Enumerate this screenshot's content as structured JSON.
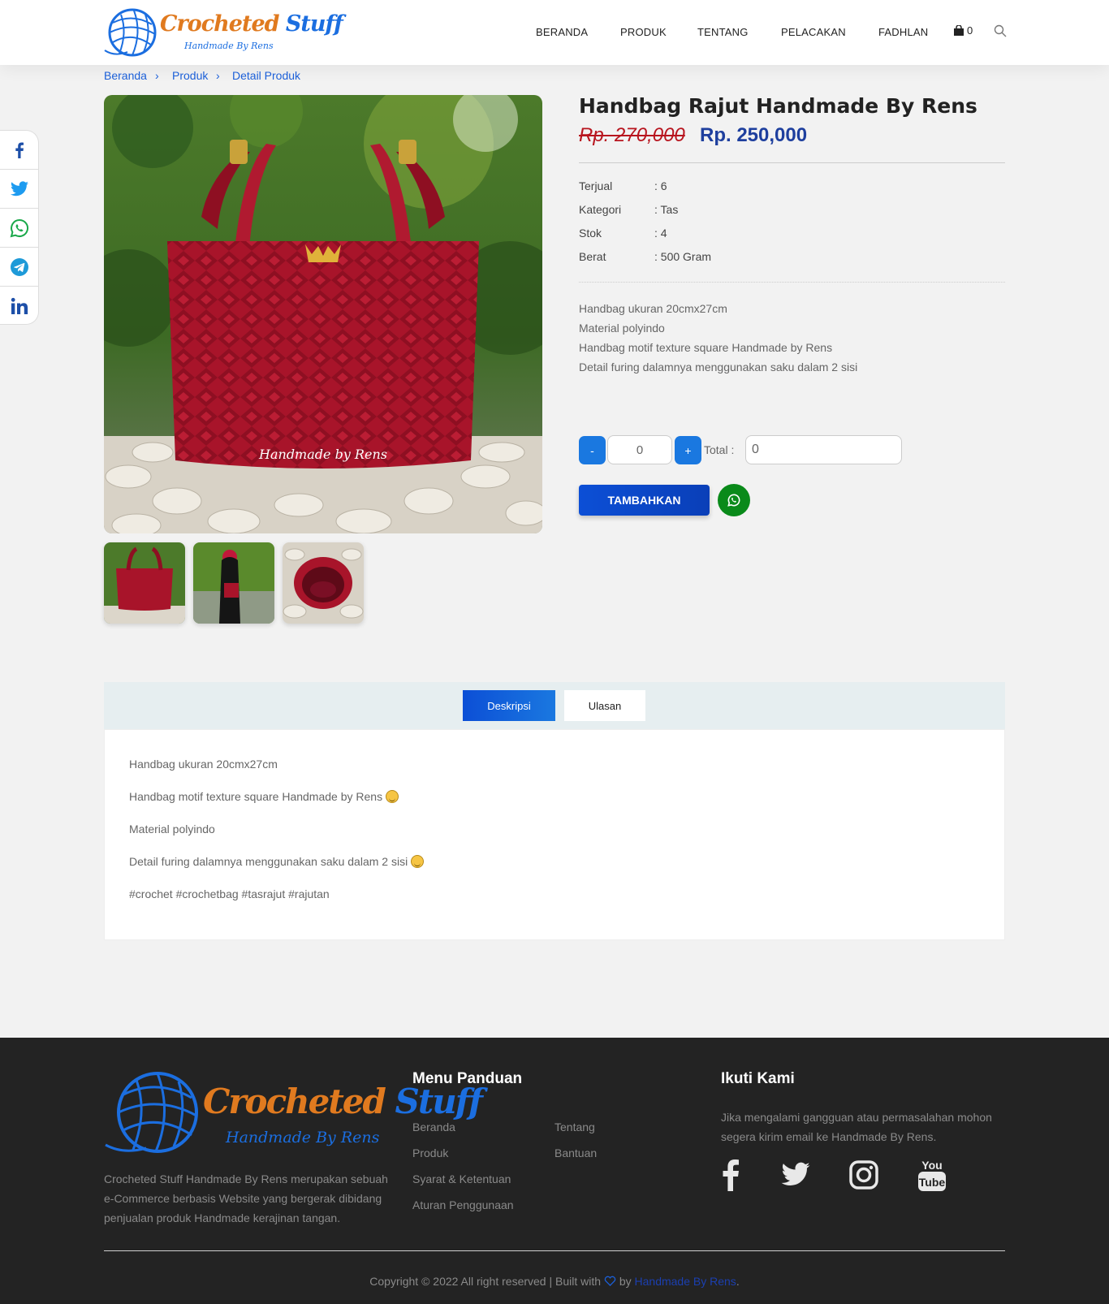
{
  "header": {
    "logo_title_a": "Crocheted",
    "logo_title_b": "Stuff",
    "logo_subtitle": "Handmade By Rens",
    "nav": [
      "BERANDA",
      "PRODUK",
      "TENTANG",
      "PELACAKAN",
      "FADHLAN"
    ],
    "cart_count": "0"
  },
  "breadcrumb": [
    "Beranda",
    "Produk",
    "Detail Produk"
  ],
  "share": [
    "facebook-icon",
    "twitter-icon",
    "whatsapp-icon",
    "telegram-icon",
    "linkedin-icon"
  ],
  "product": {
    "title": "Handbag Rajut Handmade By Rens",
    "old_price": "Rp. 270,000",
    "price": "Rp. 250,000",
    "specs": [
      {
        "label": "Terjual",
        "value": ": 6"
      },
      {
        "label": "Kategori",
        "value": ": Tas"
      },
      {
        "label": "Stok",
        "value": ": 4"
      },
      {
        "label": "Berat",
        "value": ": 500 Gram"
      }
    ],
    "short_desc": [
      "Handbag ukuran 20cmx27cm",
      "Material polyindo",
      "Handbag motif texture square Handmade by Rens",
      "Detail furing dalamnya menggunakan saku dalam 2 sisi"
    ],
    "image_caption": "Handmade by Rens",
    "qty_minus": "-",
    "qty_plus": "+",
    "qty_value": "0",
    "total_label": "Total :",
    "total_value": "0",
    "add_label": "TAMBAHKAN"
  },
  "tabs": {
    "items": [
      "Deskripsi",
      "Ulasan"
    ],
    "active": "Deskripsi",
    "content": [
      "Handbag ukuran 20cmx27cm",
      "Handbag motif texture square Handmade by Rens",
      "Material polyindo",
      "Detail furing dalamnya menggunakan saku dalam 2 sisi",
      "#crochet #crochetbag #tasrajut #rajutan"
    ]
  },
  "footer": {
    "logo_title_a": "Crocheted",
    "logo_title_b": "Stuff",
    "logo_subtitle": "Handmade By Rens",
    "about": "Crocheted Stuff Handmade By Rens merupakan sebuah e-Commerce berbasis Website yang bergerak dibidang penjualan produk Handmade kerajinan tangan.",
    "menu_title": "Menu Panduan",
    "menu_col1": [
      "Beranda",
      "Produk",
      "Syarat & Ketentuan",
      "Aturan Penggunaan"
    ],
    "menu_col2": [
      "Tentang",
      "Bantuan"
    ],
    "follow_title": "Ikuti Kami",
    "follow_text": "Jika mengalami gangguan atau permasalahan mohon segera kirim email ke Handmade By Rens.",
    "social": [
      "facebook-icon",
      "twitter-icon",
      "instagram-icon",
      "youtube-icon"
    ],
    "copyright_prefix": "Copyright © 2022 All right reserved | Built with",
    "copyright_by": "by",
    "copyright_brand": "Handmade By Rens",
    "copyright_suffix": "."
  },
  "colors": {
    "accent": "#1b5fd8",
    "price": "#1e3f9e",
    "old_price": "#b8151f",
    "whatsapp": "#0a8a1a",
    "footer_bg": "#232323"
  }
}
